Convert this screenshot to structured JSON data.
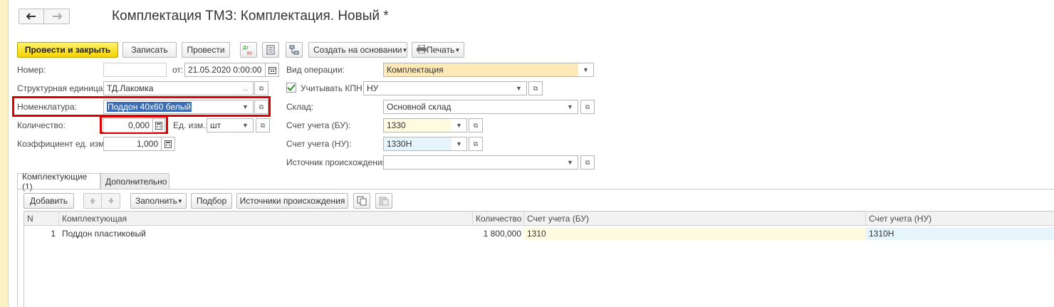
{
  "window": {
    "title": "Комплектация ТМЗ: Комплектация. Новый *",
    "back_glyph": "🡐",
    "forward_glyph": "🡒"
  },
  "toolbar": {
    "post_close": "Провести и закрыть",
    "save": "Записать",
    "post": "Провести",
    "dtkt_icon": "Дт Кт",
    "create_based": "Создать на основании",
    "print": "Печать"
  },
  "form": {
    "number_label": "Номер:",
    "number_value": "",
    "from_label": "от:",
    "date_value": "21.05.2020  0:00:00",
    "struct_unit_label": "Структурная единица:",
    "struct_unit_value": "ТД.Лакомка",
    "nomenclature_label": "Номенклатура:",
    "nomenclature_value": "Поддон 40х60 белый",
    "quantity_label": "Количество:",
    "quantity_value": "0,000",
    "unit_label": "Ед. изм.:",
    "unit_value": "шт",
    "coef_label": "Коэффициент ед. изм.:",
    "coef_value": "1,000",
    "op_type_label": "Вид операции:",
    "op_type_value": "Комплектация",
    "kpn_label": "Учитывать КПН",
    "kpn_checked": true,
    "kpn_value": "НУ",
    "warehouse_label": "Склад:",
    "warehouse_value": "Основной склад",
    "account_bu_label": "Счет учета (БУ):",
    "account_bu_value": "1330",
    "account_nu_label": "Счет учета (НУ):",
    "account_nu_value": "1330Н",
    "source_label": "Источник происхождения:",
    "source_value": ""
  },
  "tabs": [
    {
      "label": "Комплектующие (1)",
      "active": true
    },
    {
      "label": "Дополнительно",
      "active": false
    }
  ],
  "table_toolbar": {
    "add": "Добавить",
    "fill": "Заполнить",
    "pick": "Подбор",
    "sources": "Источники происхождения"
  },
  "table": {
    "columns": [
      "N",
      "Комплектующая",
      "Количество",
      "Счет учета (БУ)",
      "Счет учета (НУ)"
    ],
    "rows": [
      {
        "n": "1",
        "component": "Поддон пластиковый",
        "qty": "1 800,000",
        "acc_bu": "1310",
        "acc_nu": "1310Н"
      }
    ]
  },
  "colors": {
    "accent_yellow": "#f5d300",
    "highlight_red": "#e00000",
    "op_type_bg": "#fde9b8",
    "account_bu_bg": "#fffbe0",
    "account_nu_bg": "#e6f4fc"
  }
}
